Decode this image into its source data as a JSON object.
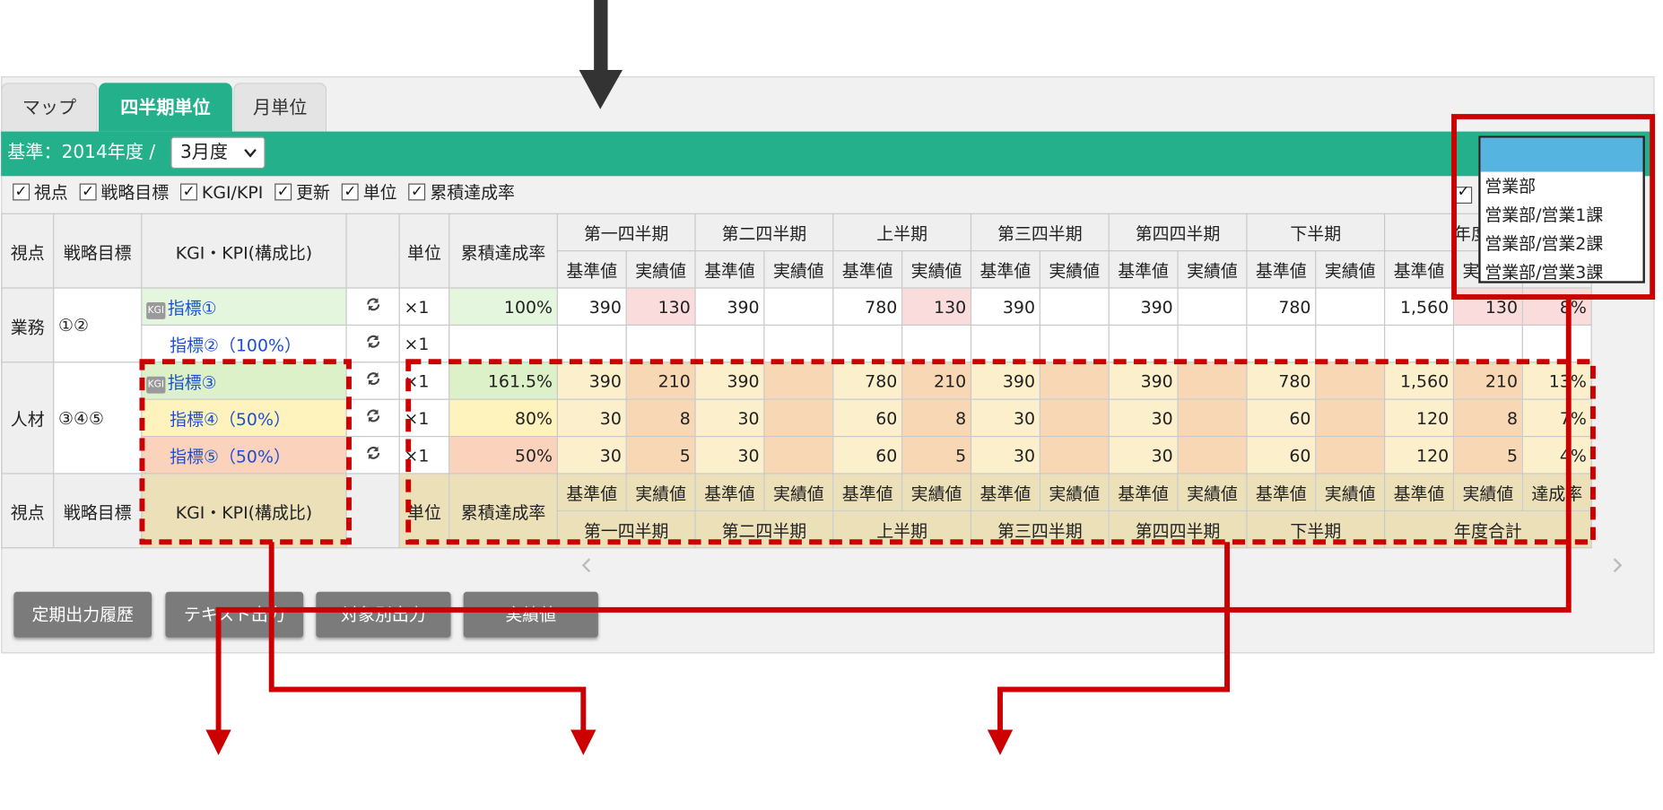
{
  "tabs": [
    "マップ",
    "四半期単位",
    "月単位"
  ],
  "basis": {
    "label": "基準：2014年度 /",
    "month": "3月度"
  },
  "checkboxes": [
    "視点",
    "戦略目標",
    "KGI/KPI",
    "更新",
    "単位",
    "累積達成率"
  ],
  "header": {
    "viewpoint": "視点",
    "strategy": "戦略目標",
    "kpi": "KGI・KPI(構成比)",
    "unit": "単位",
    "cumulative": "累積達成率",
    "periods": [
      "第一四半期",
      "第二四半期",
      "上半期",
      "第三四半期",
      "第四四半期",
      "下半期",
      "年度合計"
    ],
    "base": "基準値",
    "actual": "実績値",
    "rate": "達成率"
  },
  "rows": [
    {
      "viewpoint": "業務",
      "strategy": "①②",
      "name": "指標①",
      "kgi": true,
      "unit": "×1",
      "cum": "100%",
      "cells": [
        "390",
        "130",
        "390",
        "",
        "780",
        "130",
        "390",
        "",
        "390",
        "",
        "780",
        "",
        "1,560",
        "130",
        "8%"
      ]
    },
    {
      "name": "指標②（100%）",
      "unit": "×1",
      "cum": "",
      "cells": [
        "",
        "",
        "",
        "",
        "",
        "",
        "",
        "",
        "",
        "",
        "",
        "",
        "",
        "",
        ""
      ]
    },
    {
      "viewpoint": "人材",
      "strategy": "③④⑤",
      "name": "指標③",
      "kgi": true,
      "unit": "×1",
      "cum": "161.5%",
      "cells": [
        "390",
        "210",
        "390",
        "",
        "780",
        "210",
        "390",
        "",
        "390",
        "",
        "780",
        "",
        "1,560",
        "210",
        "13%"
      ]
    },
    {
      "name": "指標④（50%）",
      "unit": "×1",
      "cum": "80%",
      "cells": [
        "30",
        "8",
        "30",
        "",
        "60",
        "8",
        "30",
        "",
        "30",
        "",
        "60",
        "",
        "120",
        "8",
        "7%"
      ]
    },
    {
      "name": "指標⑤（50%）",
      "unit": "×1",
      "cum": "50%",
      "cells": [
        "30",
        "5",
        "30",
        "",
        "60",
        "5",
        "30",
        "",
        "30",
        "",
        "60",
        "",
        "120",
        "5",
        "4%"
      ]
    }
  ],
  "buttons": [
    "定期出力履歴",
    "テキスト出力",
    "対象別出力",
    "実績値"
  ],
  "dropdown": {
    "items": [
      "営業部",
      "営業部/営業1課",
      "営業部/営業2課",
      "営業部/営業3課"
    ]
  },
  "colors": {
    "accent": "#24b08a",
    "annotation_red": "#cc0000",
    "arrow_dark": "#333333",
    "dropdown_highlight": "#56b4e0"
  }
}
